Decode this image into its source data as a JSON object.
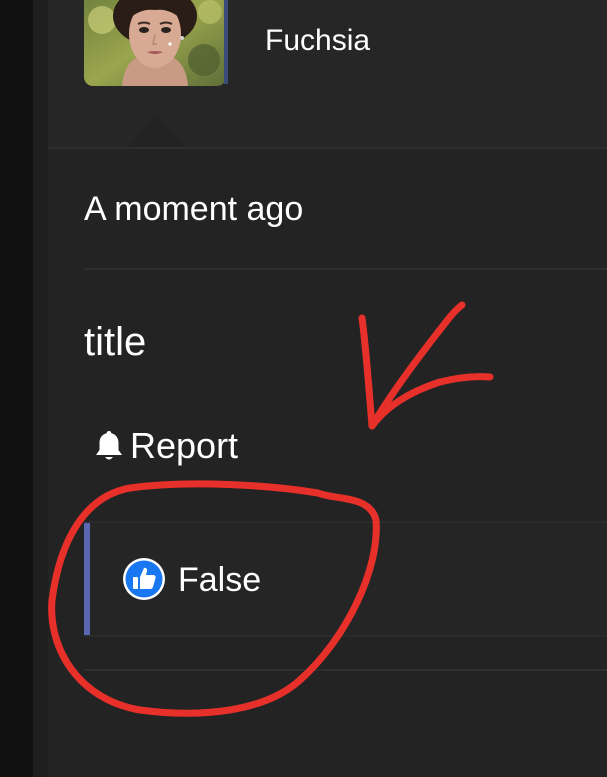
{
  "post": {
    "author": "Fuchsia",
    "timestamp": "A moment ago",
    "title": "title",
    "report_label": "Report",
    "reaction_label": "False"
  },
  "colors": {
    "accent": "#5a67b2",
    "like_icon": "#1a77f2",
    "annotation": "#e8302a"
  },
  "icons": {
    "report": "bell-icon",
    "reaction": "thumbs-up-icon"
  }
}
